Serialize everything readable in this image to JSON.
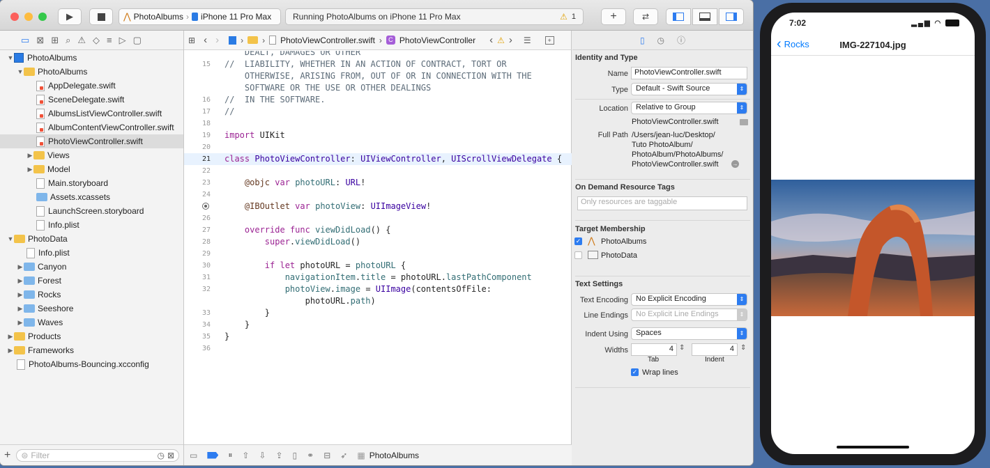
{
  "toolbar": {
    "scheme_name": "PhotoAlbums",
    "device": "iPhone 11 Pro Max",
    "status_text": "Running PhotoAlbums on iPhone 11 Pro Max",
    "warning_count": "1"
  },
  "navigator": {
    "tree": [
      {
        "label": "PhotoAlbums",
        "kind": "project",
        "depth": 0,
        "open": true
      },
      {
        "label": "PhotoAlbums",
        "kind": "folder",
        "depth": 1,
        "open": true
      },
      {
        "label": "AppDelegate.swift",
        "kind": "swift",
        "depth": 2
      },
      {
        "label": "SceneDelegate.swift",
        "kind": "swift",
        "depth": 2
      },
      {
        "label": "AlbumsListViewController.swift",
        "kind": "swift",
        "depth": 2
      },
      {
        "label": "AlbumContentViewController.swift",
        "kind": "swift",
        "depth": 2
      },
      {
        "label": "PhotoViewController.swift",
        "kind": "swift",
        "depth": 2,
        "selected": true
      },
      {
        "label": "Views",
        "kind": "folder",
        "depth": 2,
        "open": false
      },
      {
        "label": "Model",
        "kind": "folder",
        "depth": 2,
        "open": false
      },
      {
        "label": "Main.storyboard",
        "kind": "file",
        "depth": 2
      },
      {
        "label": "Assets.xcassets",
        "kind": "bluefolder-file",
        "depth": 2
      },
      {
        "label": "LaunchScreen.storyboard",
        "kind": "file",
        "depth": 2
      },
      {
        "label": "Info.plist",
        "kind": "file",
        "depth": 2
      },
      {
        "label": "PhotoData",
        "kind": "folder",
        "depth": 0,
        "open": true
      },
      {
        "label": "Info.plist",
        "kind": "file",
        "depth": 1
      },
      {
        "label": "Canyon",
        "kind": "bluefolder",
        "depth": 1,
        "open": false
      },
      {
        "label": "Forest",
        "kind": "bluefolder",
        "depth": 1,
        "open": false
      },
      {
        "label": "Rocks",
        "kind": "bluefolder",
        "depth": 1,
        "open": false
      },
      {
        "label": "Seeshore",
        "kind": "bluefolder",
        "depth": 1,
        "open": false
      },
      {
        "label": "Waves",
        "kind": "bluefolder",
        "depth": 1,
        "open": false
      },
      {
        "label": "Products",
        "kind": "folder",
        "depth": 0,
        "open": false
      },
      {
        "label": "Frameworks",
        "kind": "folder",
        "depth": 0,
        "open": false
      },
      {
        "label": "PhotoAlbums-Bouncing.xcconfig",
        "kind": "file",
        "depth": 0
      }
    ],
    "filter_placeholder": "Filter"
  },
  "editor": {
    "jump_file": "PhotoViewController.swift",
    "jump_symbol": "PhotoViewController",
    "lines": [
      {
        "n": "",
        "html": "<span class='cm'>    DEALT, DAMAGES OR OTHER</span>"
      },
      {
        "n": "15",
        "html": "<span class='cm'>//  LIABILITY, WHETHER IN AN ACTION OF CONTRACT, TORT OR</span>"
      },
      {
        "n": "",
        "html": "<span class='cm'>    OTHERWISE, ARISING FROM, OUT OF OR IN CONNECTION WITH THE</span>"
      },
      {
        "n": "",
        "html": "<span class='cm'>    SOFTWARE OR THE USE OR OTHER DEALINGS</span>"
      },
      {
        "n": "16",
        "html": "<span class='cm'>//  IN THE SOFTWARE.</span>"
      },
      {
        "n": "17",
        "html": "<span class='cm'>//</span>"
      },
      {
        "n": "18",
        "html": ""
      },
      {
        "n": "19",
        "html": "<span class='kw'>import</span> UIKit"
      },
      {
        "n": "20",
        "html": ""
      },
      {
        "n": "21",
        "html": "<span class='kw'>class</span> <span class='ty'>PhotoViewController</span>: <span class='ty'>UIViewController</span>, <span class='ty'>UIScrollViewDelegate</span> {",
        "cur": true
      },
      {
        "n": "22",
        "html": ""
      },
      {
        "n": "23",
        "html": "    <span class='at'>@objc</span> <span class='kw'>var</span> <span class='pr'>photoURL</span>: <span class='ty'>URL</span>!"
      },
      {
        "n": "24",
        "html": ""
      },
      {
        "n": "",
        "html": "    <span class='at'>@IBOutlet</span> <span class='kw'>var</span> <span class='pr'>photoView</span>: <span class='ty'>UIImageView</span>!",
        "outlet": true
      },
      {
        "n": "26",
        "html": ""
      },
      {
        "n": "27",
        "html": "    <span class='kw'>override</span> <span class='kw'>func</span> <span class='pr'>viewDidLoad</span>() {"
      },
      {
        "n": "28",
        "html": "        <span class='kw'>super</span>.<span class='pr'>viewDidLoad</span>()"
      },
      {
        "n": "29",
        "html": ""
      },
      {
        "n": "30",
        "html": "        <span class='kw'>if</span> <span class='kw'>let</span> photoURL = <span class='pr'>photoURL</span> {"
      },
      {
        "n": "31",
        "html": "            <span class='pr'>navigationItem</span>.<span class='pr'>title</span> = photoURL.<span class='pr'>lastPathComponent</span>"
      },
      {
        "n": "32",
        "html": "            <span class='pr'>photoView</span>.<span class='pr'>image</span> = <span class='ty'>UIImage</span>(contentsOfFile:"
      },
      {
        "n": "",
        "html": "                photoURL.<span class='pr'>path</span>)"
      },
      {
        "n": "33",
        "html": "        }"
      },
      {
        "n": "34",
        "html": "    }"
      },
      {
        "n": "35",
        "html": "}"
      },
      {
        "n": "36",
        "html": ""
      }
    ],
    "debug_target": "PhotoAlbums"
  },
  "inspector": {
    "identity_title": "Identity and Type",
    "name_label": "Name",
    "name_value": "PhotoViewController.swift",
    "type_label": "Type",
    "type_value": "Default - Swift Source",
    "location_label": "Location",
    "location_value": "Relative to Group",
    "location_file": "PhotoViewController.swift",
    "fullpath_label": "Full Path",
    "fullpath_1": "/Users/jean-luc/Desktop/",
    "fullpath_2": "Tuto PhotoAlbum/",
    "fullpath_3": "PhotoAlbum/PhotoAlbums/",
    "fullpath_4": "PhotoViewController.swift",
    "odr_title": "On Demand Resource Tags",
    "odr_placeholder": "Only resources are taggable",
    "target_title": "Target Membership",
    "target_1": "PhotoAlbums",
    "target_2": "PhotoData",
    "text_title": "Text Settings",
    "encoding_label": "Text Encoding",
    "encoding_value": "No Explicit Encoding",
    "endings_label": "Line Endings",
    "endings_value": "No Explicit Line Endings",
    "indent_label": "Indent Using",
    "indent_value": "Spaces",
    "widths_label": "Widths",
    "tab_value": "4",
    "indent_width_value": "4",
    "tab_caption": "Tab",
    "indent_caption": "Indent",
    "wrap_label": "Wrap lines"
  },
  "simulator": {
    "time": "7:02",
    "back_label": "Rocks",
    "nav_title": "IMG-227104.jpg"
  },
  "colors": {
    "accent": "#2d7cf0",
    "ios_blue": "#007aff"
  }
}
